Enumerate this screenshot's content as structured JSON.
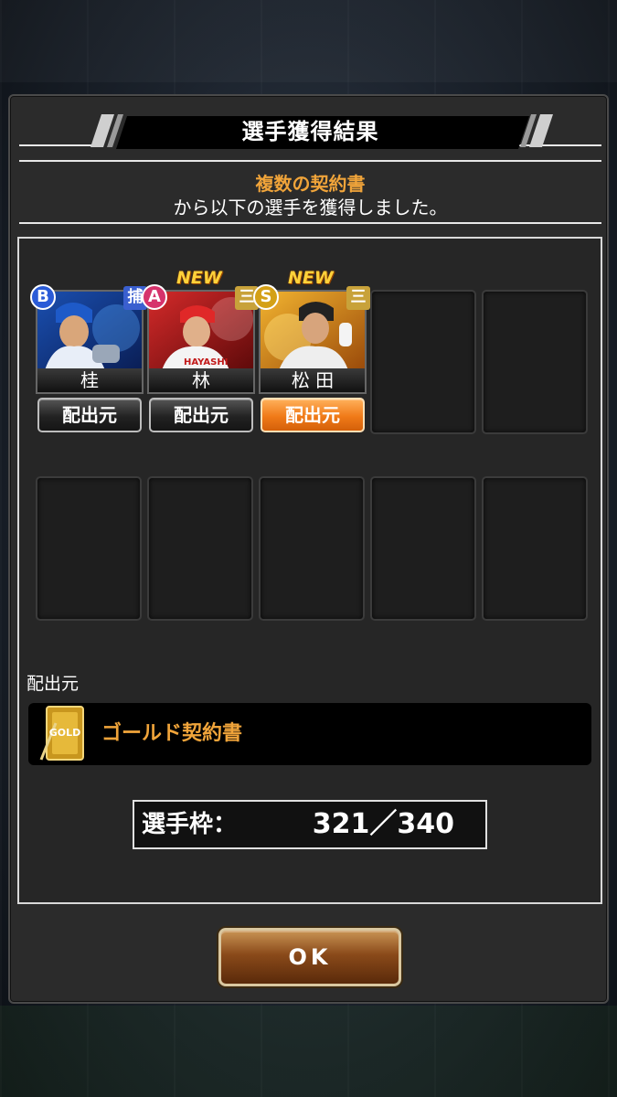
{
  "dialog": {
    "title": "選手獲得結果",
    "source_name": "複数の契約書",
    "message": "から以下の選手を獲得しました。"
  },
  "cards": [
    {
      "name": "桂",
      "rank": "B",
      "position": "捕",
      "is_new": false,
      "source_button": "配出元",
      "selected": false
    },
    {
      "name": "林",
      "rank": "A",
      "position": "三",
      "is_new": true,
      "new_label": "NEW",
      "source_button": "配出元",
      "selected": false
    },
    {
      "name": "松 田",
      "rank": "S",
      "position": "三",
      "is_new": true,
      "new_label": "NEW",
      "source_button": "配出元",
      "selected": true
    }
  ],
  "source_section": {
    "label": "配出元",
    "contract_name": "ゴールド契約書",
    "contract_icon_text": "GOLD"
  },
  "player_slots": {
    "label": "選手枠：",
    "value": "321／340"
  },
  "ok_button": {
    "label": "OK"
  },
  "colors": {
    "accent_orange": "#f0a43a",
    "rank_b": "#2a5bd7",
    "rank_a": "#d6336c",
    "rank_s": "#d4a017"
  }
}
